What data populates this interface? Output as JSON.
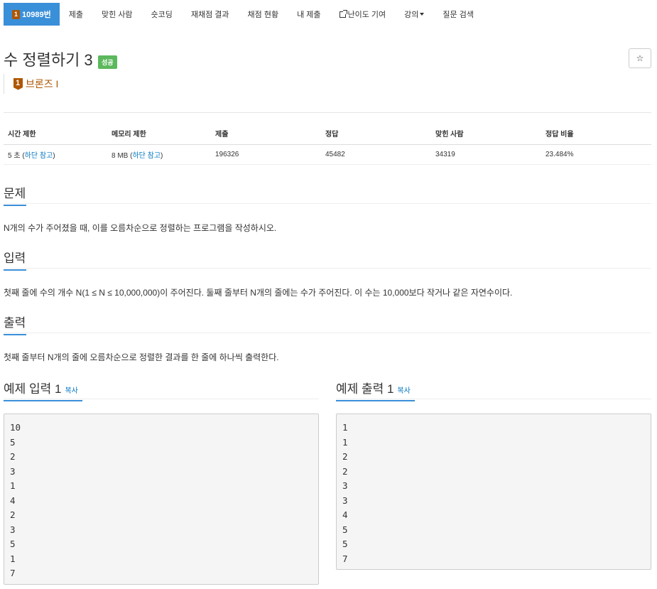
{
  "nav": {
    "problem_number": "10989번",
    "items": [
      "제출",
      "맞힌 사람",
      "숏코딩",
      "재채점 결과",
      "채점 현황",
      "내 제출",
      "난이도 기여",
      "강의",
      "질문 검색"
    ]
  },
  "problem": {
    "title": "수 정렬하기 3",
    "status_badge": "성공",
    "star": "☆",
    "tier_number": "1",
    "tier_label": "브론즈 I"
  },
  "info_table": {
    "headers": [
      "시간 제한",
      "메모리 제한",
      "제출",
      "정답",
      "맞힌 사람",
      "정답 비율"
    ],
    "time_limit": "5 초",
    "memory_limit": "8 MB",
    "note_link": "하단 참고",
    "submissions": "196326",
    "accepted": "45482",
    "solvers": "34319",
    "ratio": "23.484%"
  },
  "sections": {
    "problem_title": "문제",
    "problem_text": "N개의 수가 주어졌을 때, 이를 오름차순으로 정렬하는 프로그램을 작성하시오.",
    "input_title": "입력",
    "input_text": "첫째 줄에 수의 개수 N(1 ≤ N ≤ 10,000,000)이 주어진다. 둘째 줄부터 N개의 줄에는 수가 주어진다. 이 수는 10,000보다 작거나 같은 자연수이다.",
    "output_title": "출력",
    "output_text": "첫째 줄부터 N개의 줄에 오름차순으로 정렬한 결과를 한 줄에 하나씩 출력한다."
  },
  "samples": {
    "input_title": "예제 입력 1",
    "output_title": "예제 출력 1",
    "copy_label": "복사",
    "input_text": "10\n5\n2\n3\n1\n4\n2\n3\n5\n1\n7",
    "output_text": "1\n1\n2\n2\n3\n3\n4\n5\n5\n7"
  }
}
